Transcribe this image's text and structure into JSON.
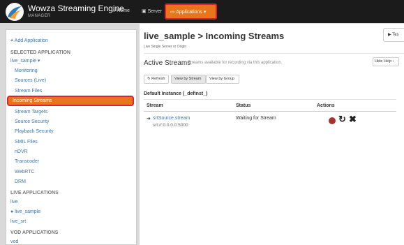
{
  "topbar": {
    "brand_name": "Wowza Streaming Engine",
    "brand_sub": "MANAGER",
    "home_label": "Home",
    "server_label": "Server",
    "applications_label": "Applications"
  },
  "sidebar": {
    "add_label": "Add Application",
    "selected_heading": "SELECTED APPLICATION",
    "app_name": "live_sample",
    "items": [
      {
        "label": "Monitoring"
      },
      {
        "label": "Sources (Live)"
      },
      {
        "label": "Stream Files"
      },
      {
        "label": "Incoming Streams"
      },
      {
        "label": "Stream Targets"
      },
      {
        "label": "Source Security"
      },
      {
        "label": "Playback Security"
      },
      {
        "label": "SMIL Files"
      },
      {
        "label": "nDVR"
      },
      {
        "label": "Transcoder"
      },
      {
        "label": "WebRTC"
      },
      {
        "label": "DRM"
      }
    ],
    "live_heading": "LIVE APPLICATIONS",
    "live_apps": [
      {
        "label": "live"
      },
      {
        "label": "live_sample"
      },
      {
        "label": "live_srt"
      }
    ],
    "vod_heading": "VOD APPLICATIONS",
    "vod_apps": [
      {
        "label": "vod"
      }
    ]
  },
  "main": {
    "title": "live_sample > Incoming Streams",
    "subtitle": "Live Single Server or Origin",
    "test_label": "Tes",
    "section_title": "Active Streams",
    "section_desc": "Streams available for recording via this application.",
    "help_label": "Hide Help",
    "refresh_label": "Refresh",
    "view_stream_label": "View by Stream",
    "view_group_label": "View by Group",
    "instance_title": "Default Instance (_definst_)",
    "columns": [
      "Stream",
      "Status",
      "Actions"
    ],
    "rows": [
      {
        "stream": "srtSource.stream",
        "source": "srt://:0.0.0.0:5000",
        "status": "Waiting for Stream"
      }
    ]
  },
  "colors": {
    "accent": "#e8751a",
    "highlight": "#d9242c",
    "link": "#3a77b5",
    "record": "#a83232"
  }
}
